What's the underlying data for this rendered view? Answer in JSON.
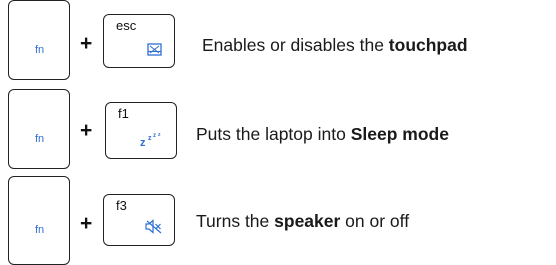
{
  "rows": [
    {
      "modifier": "fn",
      "plus": "+",
      "key_label": "esc",
      "icon": "touchpad-icon",
      "desc_pre": "Enables or disables the ",
      "desc_bold": "touchpad",
      "desc_post": ""
    },
    {
      "modifier": "fn",
      "plus": "+",
      "key_label": "f1",
      "icon": "sleep-icon",
      "desc_pre": "Puts the laptop into ",
      "desc_bold": "Sleep mode",
      "desc_post": ""
    },
    {
      "modifier": "fn",
      "plus": "+",
      "key_label": "f3",
      "icon": "speaker-mute-icon",
      "desc_pre": "Turns the ",
      "desc_bold": "speaker",
      "desc_post": " on or off"
    }
  ],
  "colors": {
    "fn_text": "#2f6fd6",
    "icon": "#2f6fd6"
  }
}
